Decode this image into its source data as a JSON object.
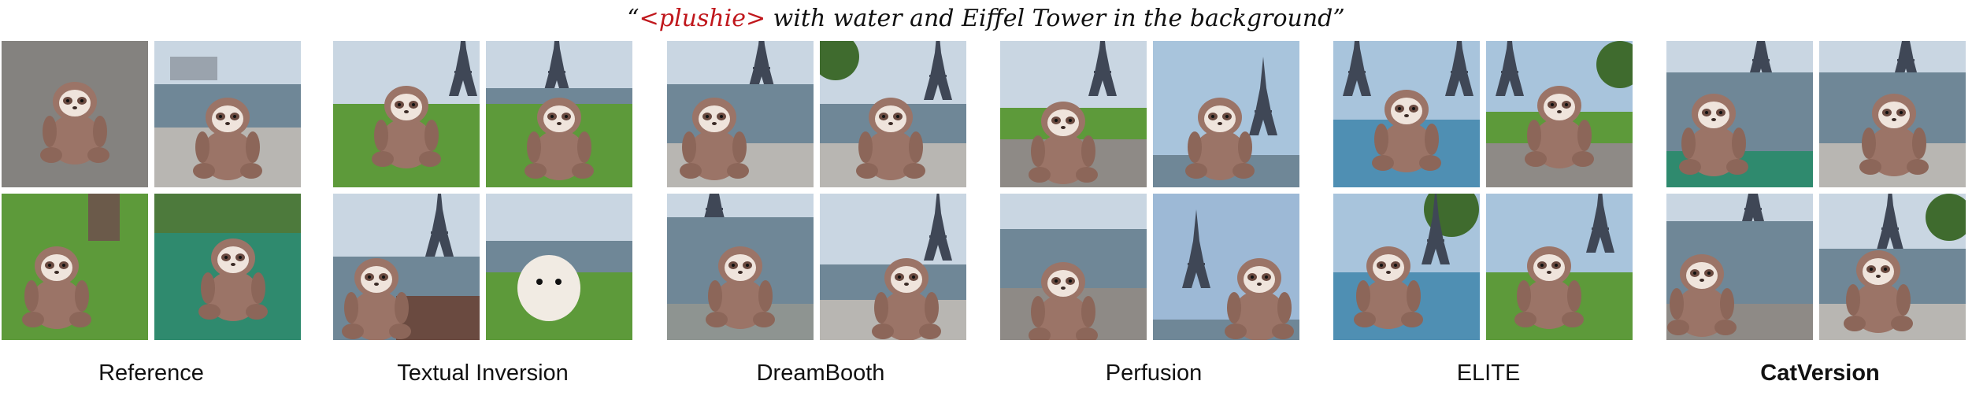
{
  "prompt": {
    "open_quote": "“",
    "token": "<plushie>",
    "rest": " with water and Eiffel Tower in the background",
    "close_quote": "”"
  },
  "methods": [
    {
      "label": "Reference"
    },
    {
      "label": "Textual Inversion"
    },
    {
      "label": "DreamBooth"
    },
    {
      "label": "Perfusion"
    },
    {
      "label": "ELITE"
    },
    {
      "label": "CatVersion"
    }
  ],
  "colors": {
    "token": "#c0171c",
    "text": "#111111",
    "sloth_fur": "#9b7467",
    "sloth_face": "#efe4dc",
    "grass": "#5d9a3a",
    "water": "#6f8797",
    "sky": "#c9d6e2"
  }
}
